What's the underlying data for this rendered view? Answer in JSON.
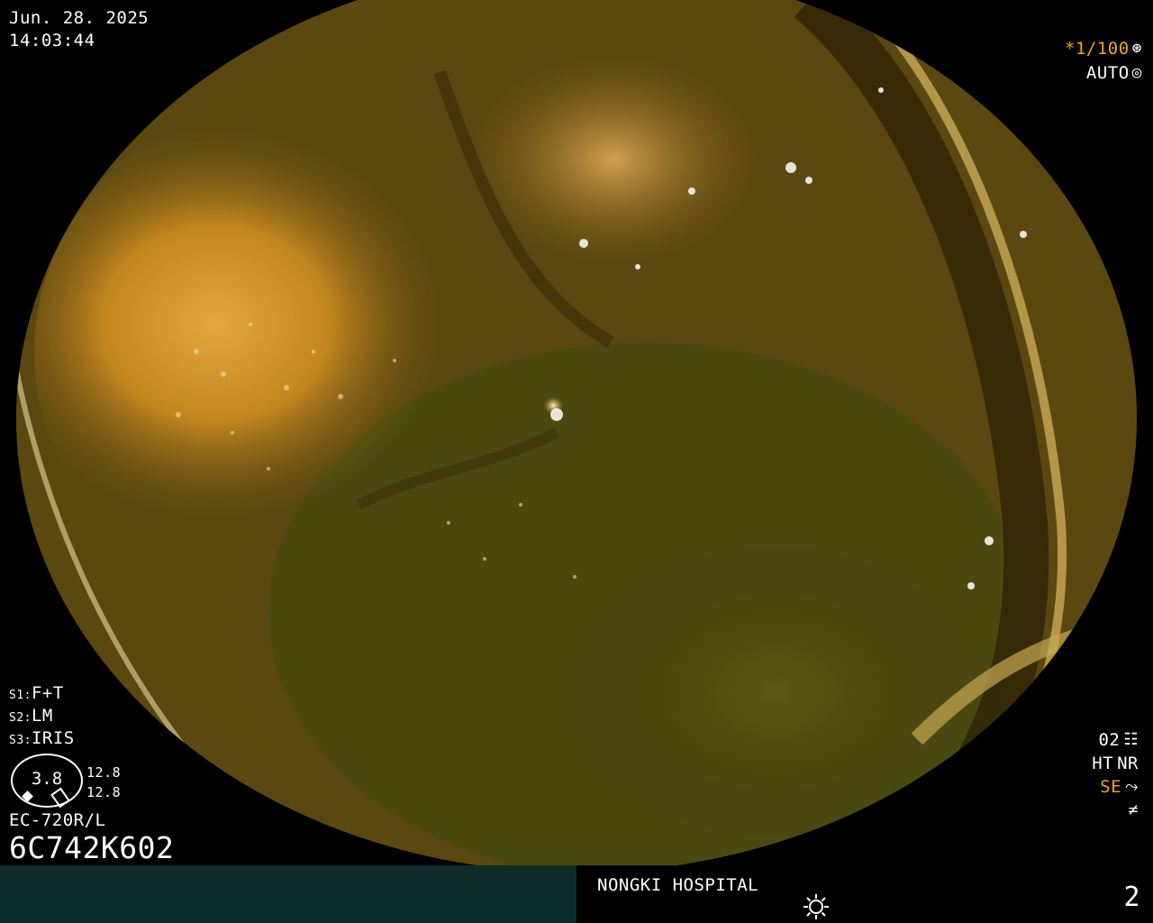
{
  "header": {
    "date": "Jun. 28. 2025",
    "time": "14:03:44"
  },
  "exposure": {
    "shutter": "*1/100",
    "shutter_icon": "shutter-icon",
    "mode": "AUTO",
    "mode_icon": "auto-iris-icon"
  },
  "settings": {
    "s1_key": "S1:",
    "s1_value": "F+T",
    "s2_key": "S2:",
    "s2_value": "LM",
    "s3_key": "S3:",
    "s3_value": "IRIS"
  },
  "iris": {
    "gauge_value": "3.8",
    "value_top": "12.8",
    "value_bottom": "12.8"
  },
  "scope": {
    "model": "EC-720R/L",
    "serial": "6C742K602"
  },
  "right_panel": {
    "code": "02",
    "code_icon": "structure-enhancement-icon",
    "ht": "HT",
    "nr": "NR",
    "se": "SE",
    "se_icon": "curve-icon",
    "last_icon": "not-equal-icon"
  },
  "footer": {
    "hospital": "NONGKI HOSPITAL",
    "light_icon": "light-source-icon",
    "page_number": "2"
  },
  "colors": {
    "accent_orange": "#f0a21e",
    "footer_panel": "#0e2c2a",
    "osd_text": "#ffffff"
  }
}
